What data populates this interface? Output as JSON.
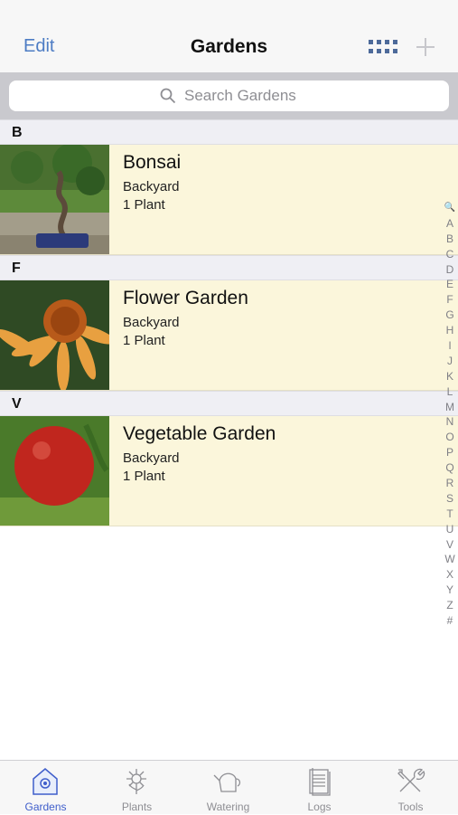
{
  "navbar": {
    "edit_label": "Edit",
    "title": "Gardens",
    "grid_icon": "grid-icon",
    "add_icon": "plus-icon"
  },
  "search": {
    "placeholder": "Search Gardens",
    "icon": "search-icon"
  },
  "sections": [
    {
      "letter": "B",
      "garden": {
        "name": "Bonsai",
        "location": "Backyard",
        "count": "1 Plant",
        "image": "bonsai-photo"
      }
    },
    {
      "letter": "F",
      "garden": {
        "name": "Flower Garden",
        "location": "Backyard",
        "count": "1 Plant",
        "image": "coneflower-photo"
      }
    },
    {
      "letter": "V",
      "garden": {
        "name": "Vegetable Garden",
        "location": "Backyard",
        "count": "1 Plant",
        "image": "tomato-photo"
      }
    }
  ],
  "index": [
    "🔍",
    "A",
    "B",
    "C",
    "D",
    "E",
    "F",
    "G",
    "H",
    "I",
    "J",
    "K",
    "L",
    "M",
    "N",
    "O",
    "P",
    "Q",
    "R",
    "S",
    "T",
    "U",
    "V",
    "W",
    "X",
    "Y",
    "Z",
    "#"
  ],
  "tabs": [
    {
      "label": "Gardens",
      "icon": "gardens-icon",
      "active": true
    },
    {
      "label": "Plants",
      "icon": "plants-icon",
      "active": false
    },
    {
      "label": "Watering",
      "icon": "watering-icon",
      "active": false
    },
    {
      "label": "Logs",
      "icon": "logs-icon",
      "active": false
    },
    {
      "label": "Tools",
      "icon": "tools-icon",
      "active": false
    }
  ],
  "colors": {
    "accent": "#4d7cc4",
    "active_tab": "#3f5ecb",
    "row_bg": "#fbf6db"
  }
}
